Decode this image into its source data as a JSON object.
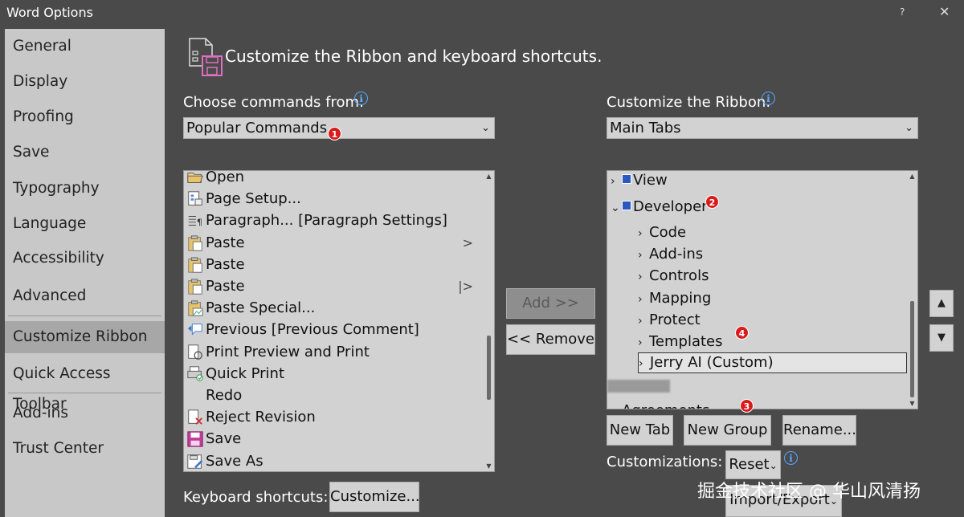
{
  "window": {
    "title": "Word Options",
    "help_glyph": "?",
    "close_glyph": "✕"
  },
  "sidebar": {
    "items": [
      {
        "label": "General"
      },
      {
        "label": "Display"
      },
      {
        "label": "Proofing"
      },
      {
        "label": "Save"
      },
      {
        "label": "Typography"
      },
      {
        "label": "Language"
      },
      {
        "label": "Accessibility"
      },
      {
        "label": "Advanced"
      },
      {
        "label": "Customize Ribbon",
        "selected": true
      },
      {
        "label": "Quick Access Toolbar"
      },
      {
        "label": "Add-ins"
      },
      {
        "label": "Trust Center"
      }
    ]
  },
  "main": {
    "heading": "Customize the Ribbon and keyboard shortcuts.",
    "choose_label": "Choose commands from:",
    "choose_value": "Popular Commands",
    "ribbon_label": "Customize the Ribbon:",
    "ribbon_value": "Main Tabs",
    "commands": [
      {
        "label": "Open",
        "icon": "folder-open-icon"
      },
      {
        "label": "Page Setup...",
        "icon": "page-setup-icon"
      },
      {
        "label": "Paragraph... [Paragraph Settings]",
        "icon": "paragraph-icon"
      },
      {
        "label": "Paste",
        "icon": "paste-icon",
        "submenu": ">"
      },
      {
        "label": "Paste",
        "icon": "paste-icon"
      },
      {
        "label": "Paste",
        "icon": "paste-icon",
        "submenu": "|>"
      },
      {
        "label": "Paste Special...",
        "icon": "paste-special-icon"
      },
      {
        "label": "Previous [Previous Comment]",
        "icon": "previous-comment-icon"
      },
      {
        "label": "Print Preview and Print",
        "icon": "print-preview-icon"
      },
      {
        "label": "Quick Print",
        "icon": "quick-print-icon"
      },
      {
        "label": "Redo",
        "icon": ""
      },
      {
        "label": "Reject Revision",
        "icon": "reject-revision-icon"
      },
      {
        "label": "Save",
        "icon": "save-icon"
      },
      {
        "label": "Save As",
        "icon": "save-as-icon"
      }
    ],
    "tree": [
      {
        "label": "View",
        "level": 0,
        "expander": ">",
        "checkbox": true
      },
      {
        "label": "Developer",
        "level": 0,
        "expander": "v",
        "checkbox": true
      },
      {
        "label": "Code",
        "level": 1,
        "expander": ">"
      },
      {
        "label": "Add-ins",
        "level": 1,
        "expander": ">"
      },
      {
        "label": "Controls",
        "level": 1,
        "expander": ">"
      },
      {
        "label": "Mapping",
        "level": 1,
        "expander": ">"
      },
      {
        "label": "Protect",
        "level": 1,
        "expander": ">"
      },
      {
        "label": "Templates",
        "level": 1,
        "expander": ">"
      },
      {
        "label": "Jerry AI (Custom)",
        "level": 1,
        "expander": ">",
        "selected": true
      },
      {
        "label": "Agreements",
        "level": 0,
        "expander": ">"
      }
    ],
    "add_label": "Add >>",
    "remove_label": "<< Remove",
    "new_tab_label": "New Tab",
    "new_group_label": "New Group",
    "rename_label": "Rename...",
    "customizations_label": "Customizations:",
    "reset_label": "Reset",
    "import_export_label": "Import/Export",
    "keyboard_label": "Keyboard shortcuts:",
    "customize_label": "Customize...",
    "move_up_glyph": "▲",
    "move_down_glyph": "▼"
  },
  "badges": [
    "1",
    "2",
    "3",
    "4"
  ],
  "watermark": "掘金技术社区 @ 华山风清扬",
  "colors": {
    "background": "#4a4a4a",
    "sidebar": "#c8c8c8",
    "badge": "#d81b1b",
    "info": "#58a6ff",
    "checkbox": "#2b59c3"
  }
}
